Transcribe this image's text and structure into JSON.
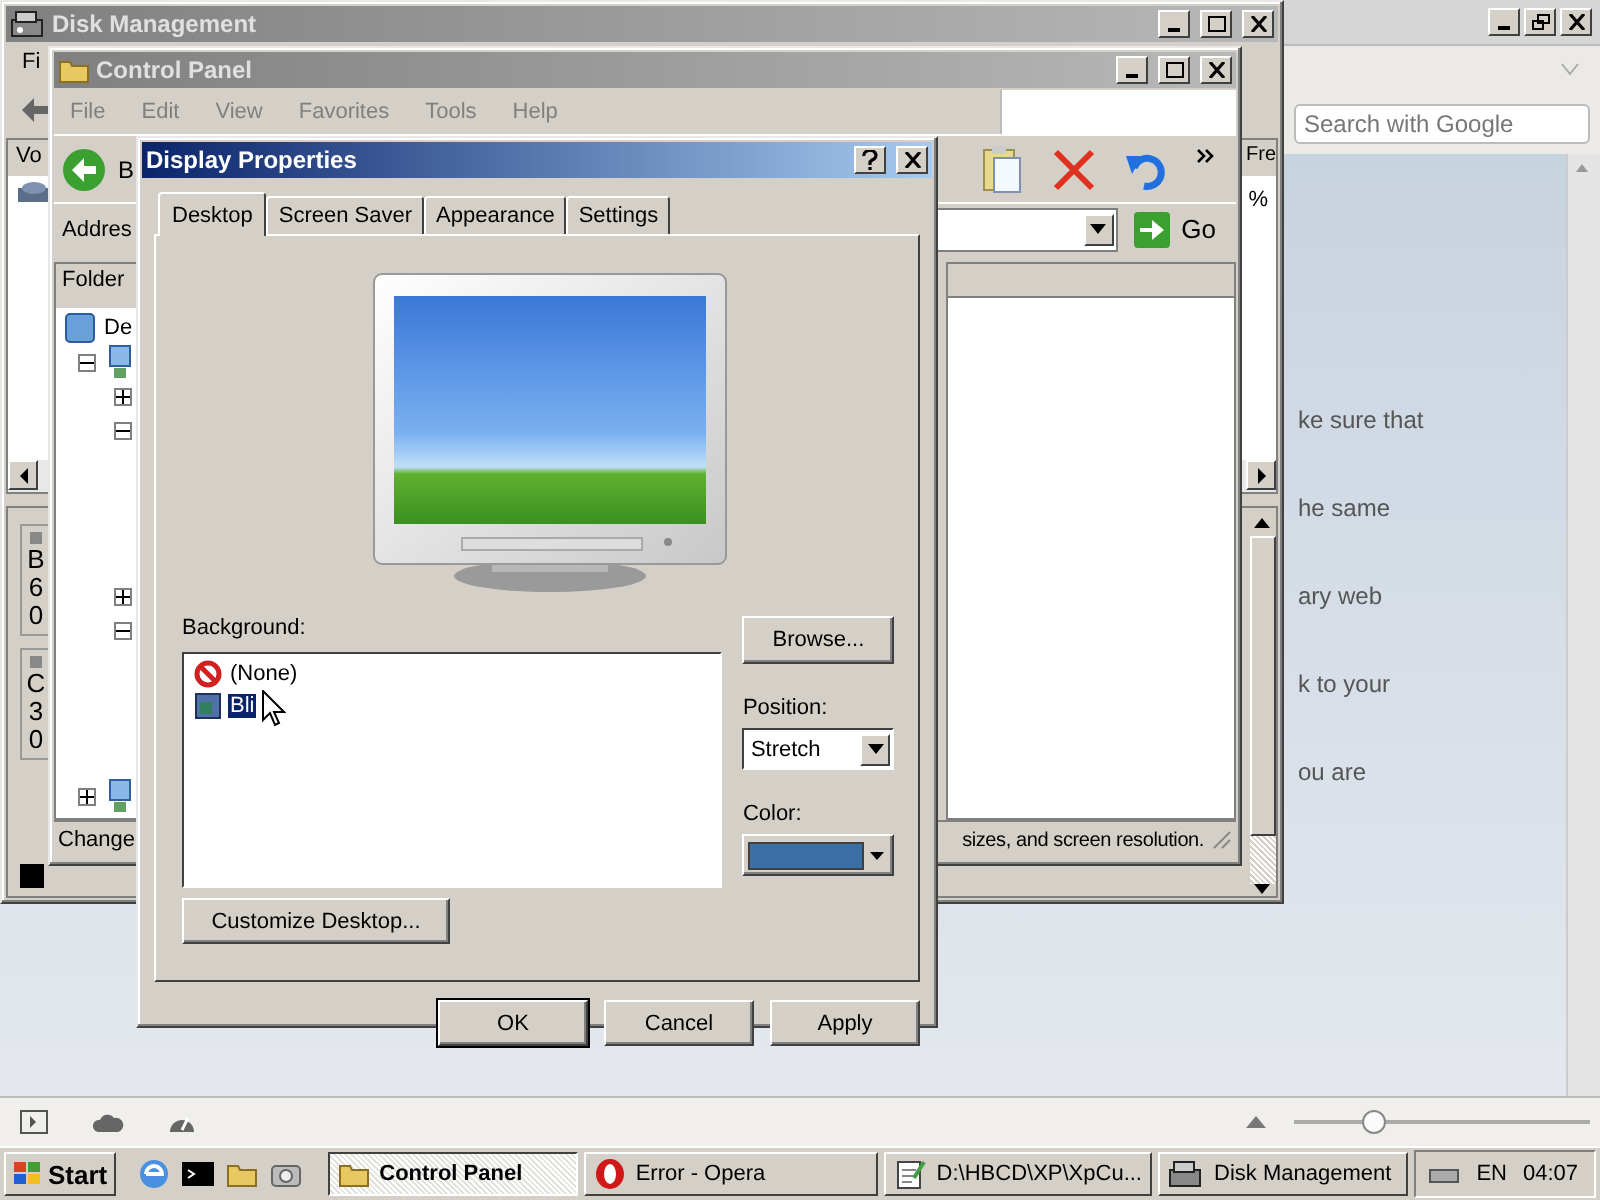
{
  "opera": {
    "search": {
      "placeholder": "Search with Google"
    },
    "page_fragments": [
      "ke sure that",
      "he same",
      "ary web",
      "k to your",
      "ou are"
    ],
    "status_bar": {
      "zoom": {
        "level": 0.27
      }
    }
  },
  "disk_management": {
    "title": "Disk Management",
    "menu": [
      "Fi"
    ],
    "list": {
      "column_1": "Vo",
      "column_2": "Fre",
      "column_2_cell": "%"
    },
    "disks": [
      {
        "lines": [
          "B",
          "6",
          "0"
        ]
      },
      {
        "lines": [
          "C",
          "3",
          "0"
        ]
      }
    ]
  },
  "control_panel": {
    "title": "Control Panel",
    "menu": [
      "File",
      "Edit",
      "View",
      "Favorites",
      "Tools",
      "Help"
    ],
    "toolbar": {
      "back_label": "B"
    },
    "address": {
      "label": "Addres",
      "go": "Go"
    },
    "folders": {
      "title": "Folder",
      "root_label": "De",
      "nodes": [
        {
          "expanded": true,
          "children": [
            {
              "expanded": false
            },
            {
              "expanded": true
            },
            {
              "expanded": false
            },
            {
              "expanded": true
            }
          ]
        },
        {
          "expanded": false
        }
      ]
    },
    "status_bar": {
      "left": "Change",
      "right": "sizes, and screen resolution."
    }
  },
  "dialog": {
    "title": "Display Properties",
    "tabs": [
      {
        "label": "Desktop",
        "selected": true
      },
      {
        "label": "Screen Saver",
        "selected": false
      },
      {
        "label": "Appearance",
        "selected": false
      },
      {
        "label": "Settings",
        "selected": false
      }
    ],
    "background": {
      "label": "Background:",
      "items": [
        {
          "label": "(None)",
          "kind": "none",
          "selected": false
        },
        {
          "label": "Bli",
          "kind": "image",
          "selected": true
        }
      ]
    },
    "browse": "Browse...",
    "position": {
      "label": "Position:",
      "value": "Stretch"
    },
    "color_picker": {
      "label": "Color:",
      "color": "#3a6ea5"
    },
    "customize": "Customize Desktop...",
    "buttons": [
      {
        "label": "OK",
        "default": true
      },
      {
        "label": "Cancel",
        "default": false
      },
      {
        "label": "Apply",
        "default": false
      }
    ]
  },
  "taskbar": {
    "start": "Start",
    "tasks": [
      {
        "label": "Control Panel",
        "kind": "folder",
        "selected": true
      },
      {
        "label": "Error - Opera",
        "kind": "opera",
        "selected": false
      },
      {
        "label": "D:\\HBCD\\XP\\XpCu...",
        "kind": "notepad",
        "selected": false
      },
      {
        "label": "Disk Management",
        "kind": "disk",
        "selected": false
      }
    ],
    "language": "EN",
    "clock": "04:07"
  }
}
